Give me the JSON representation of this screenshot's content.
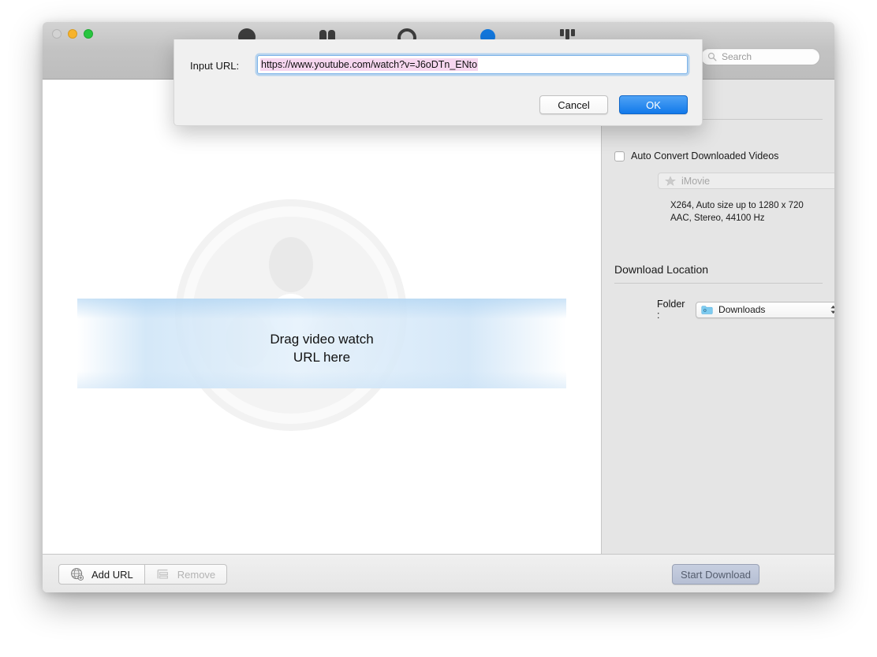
{
  "window": {
    "traffic_lights": [
      {
        "name": "close",
        "color": "#d3d3d3"
      },
      {
        "name": "minimize",
        "color": "#f7b32b"
      },
      {
        "name": "maximize",
        "color": "#28c53f"
      }
    ]
  },
  "toolbar": {
    "items": [
      {
        "icon": "download-icon"
      },
      {
        "icon": "convert-icon"
      },
      {
        "icon": "record-icon"
      },
      {
        "icon": "transfer-icon"
      },
      {
        "icon": "settings-icon"
      }
    ]
  },
  "search": {
    "placeholder": "Search",
    "value": ""
  },
  "content": {
    "drop_text_line1": "Drag video watch",
    "drop_text_line2": "URL here"
  },
  "sidebar": {
    "auto_convert": {
      "label": "Auto Convert Downloaded Videos",
      "checked": false
    },
    "preset": {
      "value": "iMovie",
      "enabled": false
    },
    "codec_line1": "X264, Auto size up to 1280 x 720",
    "codec_line2": "AAC, Stereo, 44100 Hz",
    "download_location_title": "Download Location",
    "folder": {
      "label": "Folder :",
      "value": "Downloads"
    }
  },
  "bottom_bar": {
    "add_url_label": "Add URL",
    "remove_label": "Remove",
    "start_download_label": "Start Download"
  },
  "dialog": {
    "label": "Input URL:",
    "url_value": "https://www.youtube.com/watch?v=J6oDTn_ENto",
    "url_placeholder": "",
    "cancel_label": "Cancel",
    "ok_label": "OK",
    "accent_color": "#1279ea",
    "selection_color": "#f6d6ef"
  }
}
